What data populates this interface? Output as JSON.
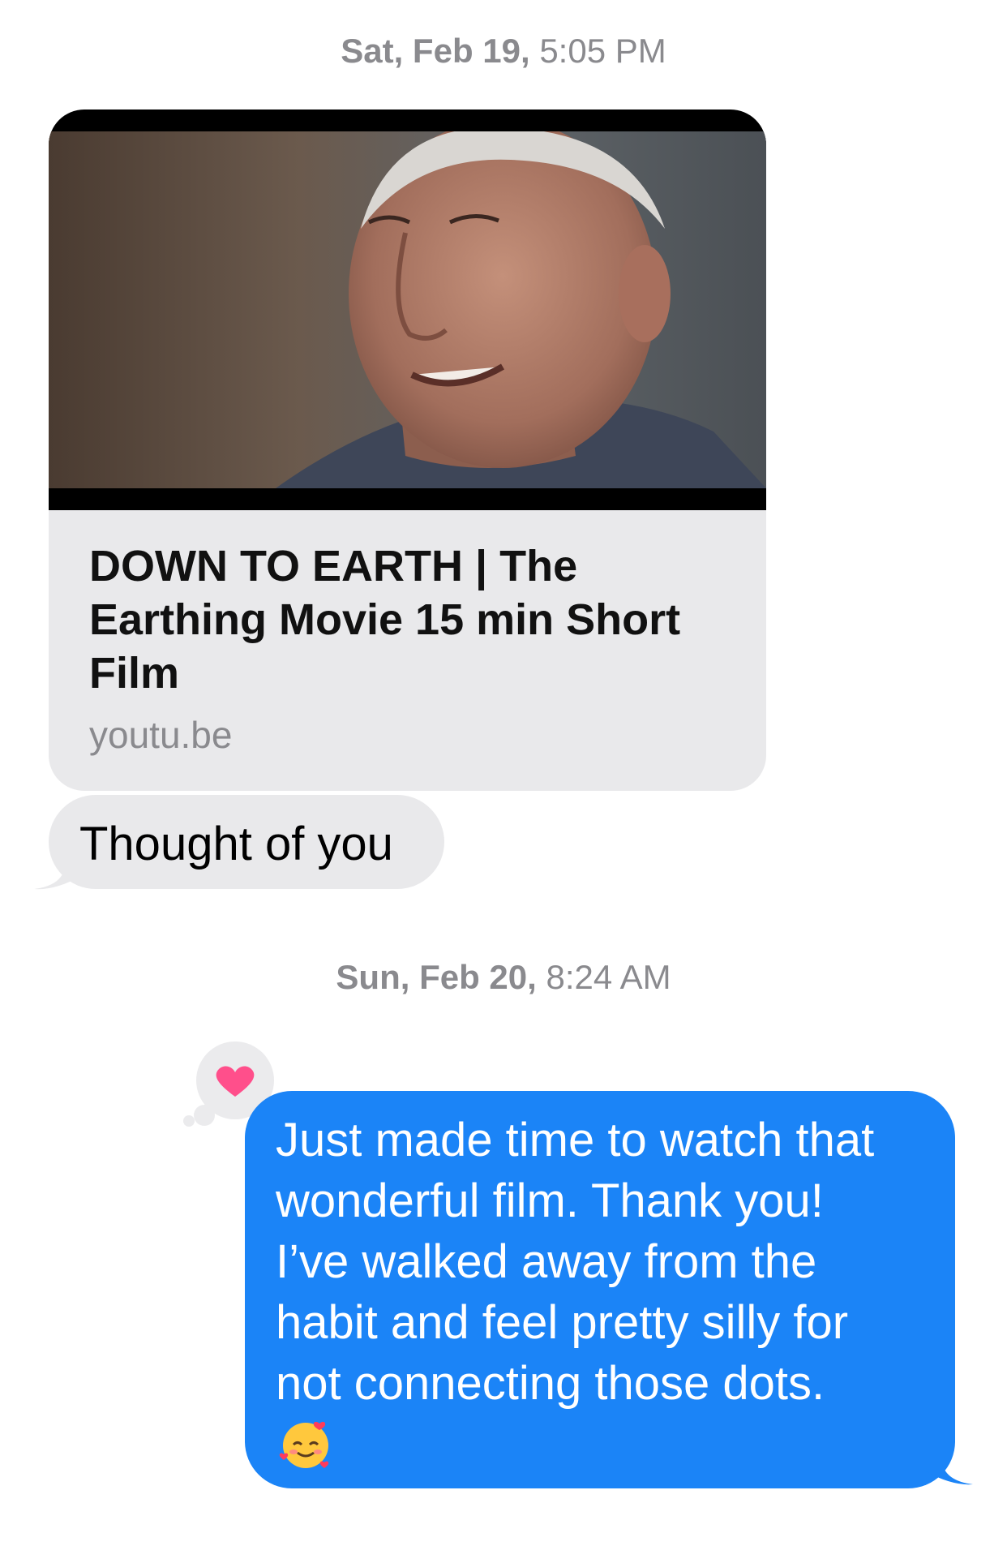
{
  "conversation": {
    "timestamp1": {
      "day": "Sat, Feb 19,",
      "time": "5:05 PM"
    },
    "link_preview": {
      "title": "DOWN TO EARTH | The Earthing Movie 15 min Short Film",
      "domain": "youtu.be"
    },
    "message_in": {
      "text": "Thought of you"
    },
    "timestamp2": {
      "day": "Sun, Feb 20,",
      "time": "8:24 AM"
    },
    "reaction": {
      "icon": "heart-icon",
      "color": "#ff4f8b"
    },
    "message_out": {
      "lines": [
        "Just made time to watch that",
        "wonderful film. Thank you!",
        "I’ve walked away from the",
        "habit and feel pretty silly for",
        "not connecting those dots."
      ],
      "emoji": "smiling-face-with-hearts-icon"
    }
  },
  "colors": {
    "sent_bubble": "#1b84f7",
    "received_bubble": "#e9e9eb",
    "timestamp_text": "#8a8a8e"
  }
}
